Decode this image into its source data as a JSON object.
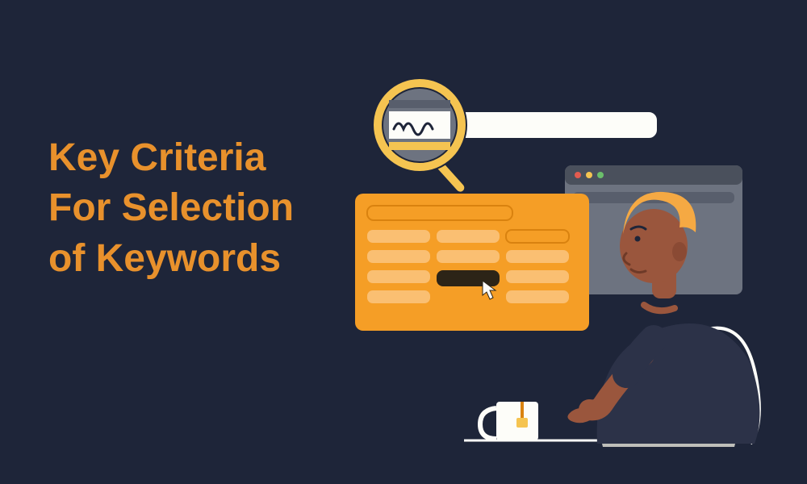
{
  "title": "Key Criteria For Selection of Keywords",
  "colors": {
    "background": "#1e2539",
    "accent": "#e8912c",
    "orange_panel": "#f59e26",
    "orange_light": "#fabf72",
    "orange_dark": "#d9820f",
    "gray_panel": "#6d7380",
    "gray_dark": "#4a505c",
    "white": "#fdfdf9",
    "skin": "#9a563d",
    "hair": "#f5a943",
    "shirt": "#2c3248"
  }
}
